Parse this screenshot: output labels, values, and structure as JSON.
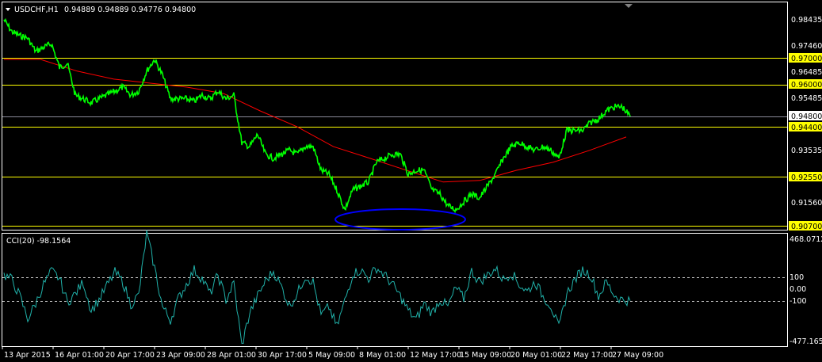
{
  "header": {
    "symbol_label": "USDCHF,H1",
    "ohlc": "0.94889 0.94889 0.94776 0.94800"
  },
  "indicator": {
    "label": "CCI(20) -98.1564",
    "max_label": "468.0712",
    "upper_label": "100",
    "zero_label": "0.00",
    "lower_label": "-100",
    "min_label": "-477.1659"
  },
  "price_axis": {
    "ticks": [
      "0.98435",
      "0.97460",
      "0.96485",
      "0.95485",
      "0.93535",
      "0.91560"
    ],
    "levels": [
      "0.97000",
      "0.96000",
      "0.94400",
      "0.92550",
      "0.90700"
    ],
    "current": "0.94800"
  },
  "time_axis": [
    "13 Apr 2015",
    "16 Apr 01:00",
    "20 Apr 17:00",
    "23 Apr 09:00",
    "28 Apr 01:00",
    "30 Apr 17:00",
    "5 May 09:00",
    "8 May 01:00",
    "12 May 17:00",
    "15 May 09:00",
    "20 May 01:00",
    "22 May 17:00",
    "27 May 09:00"
  ],
  "colors": {
    "price": "#00ff00",
    "ma": "#ff0000",
    "cci": "#20b2aa",
    "level": "#ffff00",
    "ellipse": "#0000ff"
  },
  "chart_data": {
    "type": "line",
    "title": "USDCHF,H1",
    "ylim": [
      0.905,
      0.989
    ],
    "series": [
      {
        "name": "USDCHF H1",
        "values": [
          0.9843,
          0.9798,
          0.9783,
          0.9774,
          0.9724,
          0.9739,
          0.9753,
          0.9664,
          0.9679,
          0.956,
          0.9546,
          0.9531,
          0.9546,
          0.956,
          0.9575,
          0.959,
          0.956,
          0.9575,
          0.965,
          0.9694,
          0.9635,
          0.9546,
          0.9546,
          0.9546,
          0.9537,
          0.956,
          0.9546,
          0.9575,
          0.9546,
          0.956,
          0.9382,
          0.9367,
          0.9412,
          0.9338,
          0.9323,
          0.9338,
          0.9353,
          0.9338,
          0.9367,
          0.9367,
          0.9278,
          0.9263,
          0.9204,
          0.913,
          0.9204,
          0.9219,
          0.9234,
          0.9308,
          0.9323,
          0.9338,
          0.9338,
          0.9263,
          0.9278,
          0.9278,
          0.9204,
          0.9189,
          0.9145,
          0.913,
          0.916,
          0.9189,
          0.9174,
          0.9219,
          0.9263,
          0.9323,
          0.9367,
          0.9382,
          0.9367,
          0.9353,
          0.9367,
          0.9353,
          0.9323,
          0.9427,
          0.9427,
          0.9427,
          0.9457,
          0.9471,
          0.9501,
          0.9516,
          0.9516,
          0.948
        ]
      },
      {
        "name": "Moving Average",
        "values": [
          0.9694,
          0.9694,
          0.965,
          0.962,
          0.9605,
          0.959,
          0.9566,
          0.9501,
          0.9442,
          0.9367,
          0.9323,
          0.9278,
          0.9234,
          0.924,
          0.9278,
          0.9308,
          0.9353,
          0.9403
        ],
        "step": 5
      }
    ],
    "levels": [
      0.97,
      0.96,
      0.948,
      0.944,
      0.9255,
      0.907
    ],
    "cci": {
      "name": "CCI(20)",
      "ylim": [
        -477.1659,
        468.0712
      ],
      "levels": [
        100,
        0,
        -100
      ],
      "values": [
        120,
        80,
        -60,
        -250,
        -120,
        40,
        150,
        90,
        -110,
        -40,
        60,
        -180,
        -90,
        30,
        140,
        60,
        -130,
        -50,
        468,
        180,
        -150,
        -260,
        -80,
        40,
        160,
        90,
        -40,
        120,
        -90,
        50,
        -477,
        -200,
        -60,
        70,
        150,
        20,
        -140,
        -40,
        110,
        60,
        -220,
        -150,
        -320,
        -100,
        130,
        160,
        90,
        180,
        120,
        40,
        -60,
        -180,
        -260,
        -120,
        -200,
        -90,
        -150,
        10,
        -80,
        150,
        60,
        120,
        170,
        80,
        140,
        40,
        -20,
        60,
        -60,
        -140,
        -330,
        -40,
        80,
        160,
        120,
        -60,
        60,
        -50,
        -90,
        -98
      ]
    }
  }
}
